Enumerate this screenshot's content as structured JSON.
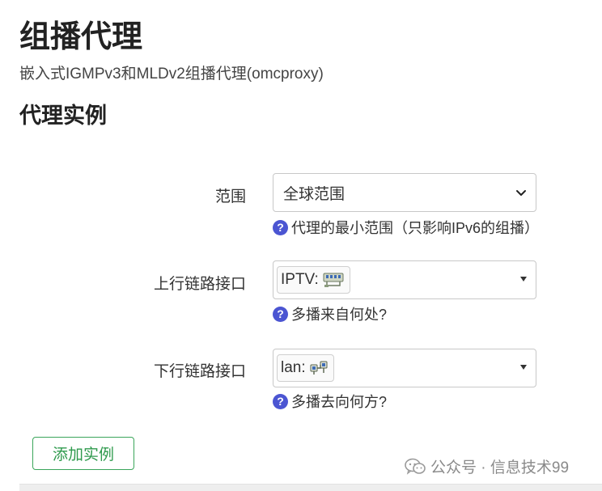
{
  "page": {
    "title": "组播代理",
    "description": "嵌入式IGMPv3和MLDv2组播代理(omcproxy)",
    "section_title": "代理实例"
  },
  "form": {
    "scope": {
      "label": "范围",
      "value": "全球范围",
      "hint": "代理的最小范围（只影响IPv6的组播）"
    },
    "uplink": {
      "label": "上行链路接口",
      "value": "IPTV:",
      "icon": "network-interface-icon",
      "hint": "多播来自何处?"
    },
    "downlink": {
      "label": "下行链路接口",
      "value": "lan:",
      "icon": "bridge-interface-icon",
      "hint": "多播去向何方?"
    },
    "hint_icon_glyph": "?"
  },
  "actions": {
    "add_label": "添加实例"
  },
  "watermark": {
    "text": "公众号 · 信息技术99"
  },
  "colors": {
    "accent_green": "#3aa55a",
    "help_icon": "#4b55d2"
  }
}
